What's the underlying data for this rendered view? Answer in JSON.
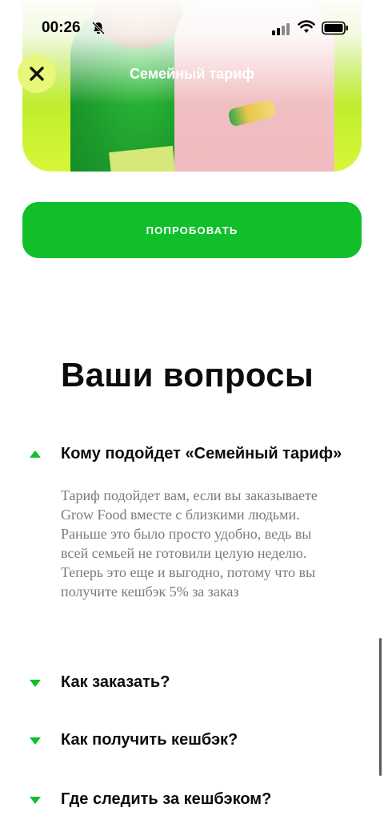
{
  "status_bar": {
    "time": "00:26"
  },
  "header": {
    "title": "Семейный тариф"
  },
  "cta": {
    "label": "ПОПРОБОВАТЬ"
  },
  "faq": {
    "heading": "Ваши вопросы",
    "items": [
      {
        "question": "Кому подойдет «Семейный тариф»",
        "expanded": true,
        "answer": "Тариф подойдет вам, если вы заказываете Grow Food вместе с близкими людьми. Раньше это было просто удобно, ведь вы всей семьей не готовили целую неделю. Теперь это еще и выгодно, потому что вы получите кешбэк 5% за заказ"
      },
      {
        "question": "Как заказать?",
        "expanded": false
      },
      {
        "question": "Как получить кешбэк?",
        "expanded": false
      },
      {
        "question": "Где следить за кешбэком?",
        "expanded": false
      }
    ]
  },
  "colors": {
    "accent_green": "#10bf2a",
    "close_bg": "#e8f67a"
  },
  "icons": [
    "bell-slash-icon",
    "signal-icon",
    "wifi-icon",
    "battery-icon",
    "close-icon",
    "chevron-up-icon",
    "chevron-down-icon"
  ]
}
